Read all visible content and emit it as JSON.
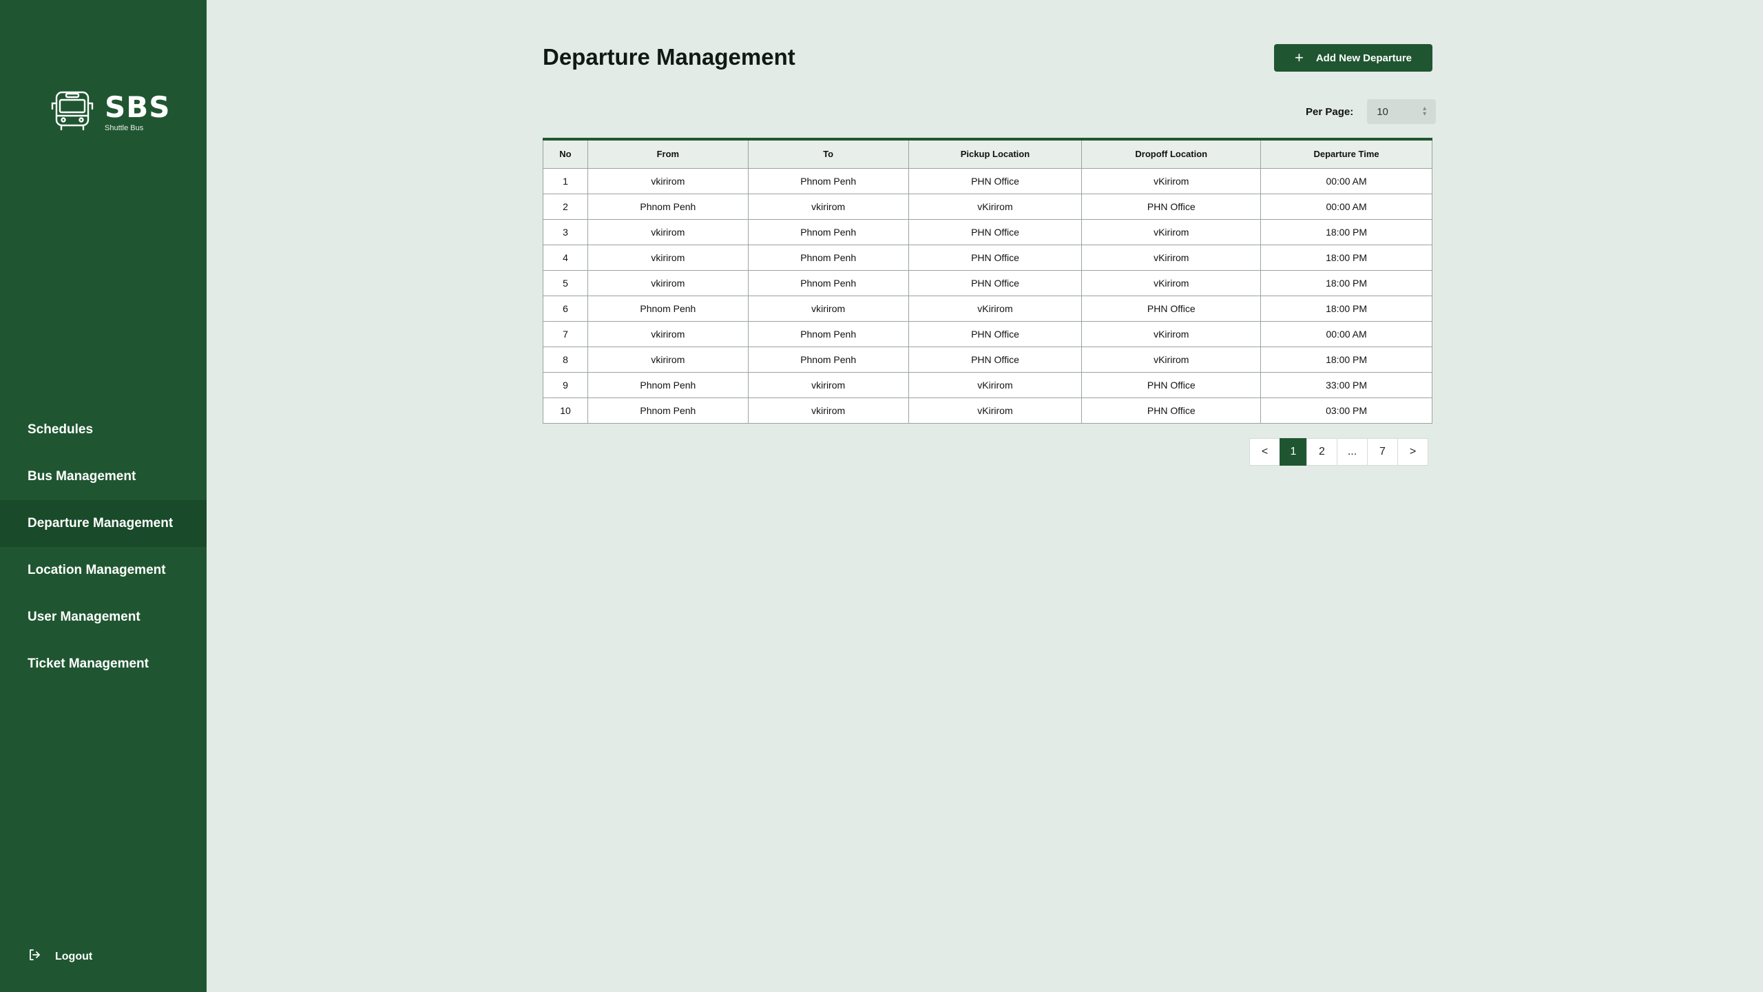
{
  "brand": {
    "name": "SBS",
    "subtitle": "Shuttle Bus"
  },
  "sidebar": {
    "items": [
      {
        "label": "Schedules",
        "active": false
      },
      {
        "label": "Bus Management",
        "active": false
      },
      {
        "label": "Departure Management",
        "active": true
      },
      {
        "label": "Location Management",
        "active": false
      },
      {
        "label": "User Management",
        "active": false
      },
      {
        "label": "Ticket Management",
        "active": false
      }
    ],
    "logout_label": "Logout"
  },
  "header": {
    "title": "Departure Management",
    "add_button_label": "Add New Departure",
    "add_icon": "plus-icon"
  },
  "per_page": {
    "label": "Per Page:",
    "value": "10"
  },
  "table": {
    "columns": [
      "No",
      "From",
      "To",
      "Pickup Location",
      "Dropoff Location",
      "Departure Time"
    ],
    "rows": [
      [
        "1",
        "vkirirom",
        "Phnom Penh",
        "PHN Office",
        "vKirirom",
        "00:00 AM"
      ],
      [
        "2",
        "Phnom Penh",
        "vkirirom",
        "vKirirom",
        "PHN Office",
        "00:00 AM"
      ],
      [
        "3",
        "vkirirom",
        "Phnom Penh",
        "PHN Office",
        "vKirirom",
        "18:00 PM"
      ],
      [
        "4",
        "vkirirom",
        "Phnom Penh",
        "PHN Office",
        "vKirirom",
        "18:00 PM"
      ],
      [
        "5",
        "vkirirom",
        "Phnom Penh",
        "PHN Office",
        "vKirirom",
        "18:00 PM"
      ],
      [
        "6",
        "Phnom Penh",
        "vkirirom",
        "vKirirom",
        "PHN Office",
        "18:00 PM"
      ],
      [
        "7",
        "vkirirom",
        "Phnom Penh",
        "PHN Office",
        "vKirirom",
        "00:00 AM"
      ],
      [
        "8",
        "vkirirom",
        "Phnom Penh",
        "PHN Office",
        "vKirirom",
        "18:00 PM"
      ],
      [
        "9",
        "Phnom Penh",
        "vkirirom",
        "vKirirom",
        "PHN Office",
        "33:00 PM"
      ],
      [
        "10",
        "Phnom Penh",
        "vkirirom",
        "vKirirom",
        "PHN Office",
        "03:00 PM"
      ]
    ]
  },
  "pagination": {
    "prev_label": "<",
    "next_label": ">",
    "pages": [
      "1",
      "2",
      "...",
      "7"
    ],
    "current": "1"
  },
  "colors": {
    "primary": "#1f5631",
    "sidebar_active": "#194a29",
    "background": "#e3ebe6"
  }
}
